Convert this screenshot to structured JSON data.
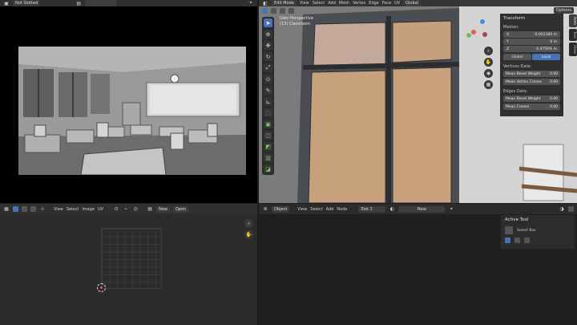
{
  "render_panel": {
    "header": {
      "name_field": "Not Slotted"
    }
  },
  "viewport": {
    "header": {
      "mode": "Edit Mode",
      "menus": [
        "View",
        "Select",
        "Add",
        "Mesh",
        "Vertex",
        "Edge",
        "Face",
        "UV"
      ],
      "orientation": "Global",
      "options": "Options"
    },
    "overlay_text": {
      "view_name": "User Perspective",
      "object_name": "(13) Classroom"
    },
    "toolbar": [
      "cursor-tool",
      "move-tool",
      "rotate-tool",
      "scale-tool",
      "transform-tool",
      "annotate-tool",
      "measure-tool",
      "add-cube-tool",
      "extrude-tool",
      "inset-tool",
      "bevel-tool",
      "loop-cut-tool",
      "knife-tool",
      "poly-build-tool"
    ],
    "n_panel": {
      "title": "Transform",
      "median_label": "Median:",
      "fields": [
        {
          "axis": "X",
          "value": "-0.001384 m"
        },
        {
          "axis": "Y",
          "value": "0 m"
        },
        {
          "axis": "Z",
          "value": "0.4759% m"
        }
      ],
      "space_buttons": [
        "Global",
        "Local"
      ],
      "vertices_label": "Vertices Data:",
      "vertices_rows": [
        {
          "label": "Mean Bevel Weight",
          "value": "0.00"
        },
        {
          "label": "Mean Vertex Crease",
          "value": "0.00"
        }
      ],
      "edges_label": "Edges Data:",
      "edges_rows": [
        {
          "label": "Mean Bevel Weight",
          "value": "0.00"
        },
        {
          "label": "Mean Crease",
          "value": "0.00"
        }
      ]
    },
    "side_tabs": [
      "Item",
      "Tool",
      "View"
    ]
  },
  "uv_editor": {
    "header": {
      "menus": [
        "View",
        "Select",
        "Image",
        "UV"
      ],
      "new_label": "New",
      "open_label": "Open"
    }
  },
  "node_editor": {
    "header": {
      "object_label": "Object",
      "menus": [
        "View",
        "Select",
        "Add",
        "Node"
      ],
      "slot_label": "Slot 2",
      "new_label": "New"
    },
    "tool_panel": {
      "title": "Active Tool",
      "select_label": "Select Box"
    }
  },
  "colors": {
    "accent": "#4772b3",
    "header": "#303030",
    "window_frame": "#4a4e52",
    "panel": "#c7a07c"
  }
}
